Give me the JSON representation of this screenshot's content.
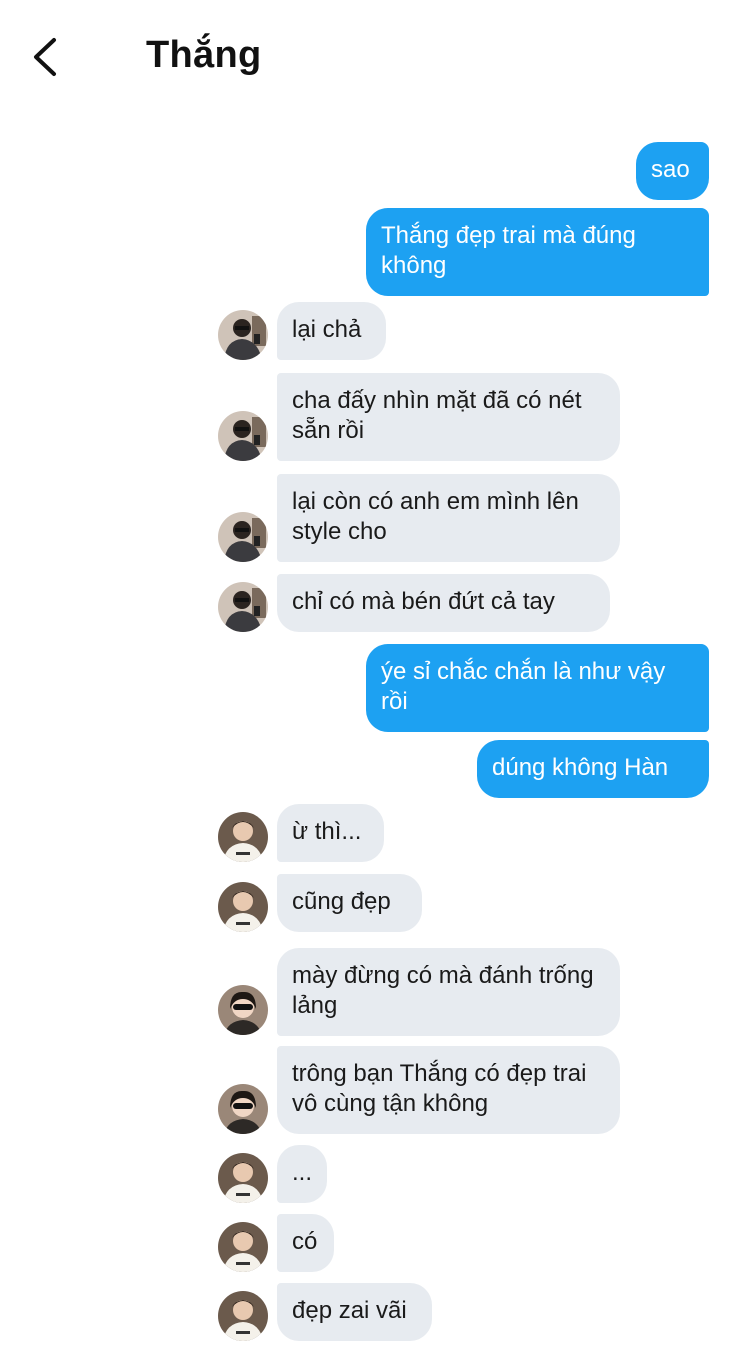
{
  "header": {
    "title": "Thắng",
    "back_icon": "chevron-left-icon"
  },
  "colors": {
    "outgoing": "#1da1f2",
    "incoming": "#e7ebf0"
  },
  "messages": [
    {
      "dir": "out",
      "text": "sao"
    },
    {
      "dir": "out",
      "text": "Thắng đẹp trai mà đúng không"
    },
    {
      "dir": "in",
      "avatar": "friend-a",
      "text": "lại chả"
    },
    {
      "dir": "in",
      "avatar": "friend-a",
      "text": "cha đấy nhìn mặt đã có nét sẵn rồi"
    },
    {
      "dir": "in",
      "avatar": "friend-a",
      "text": "lại còn có anh em mình lên style cho"
    },
    {
      "dir": "in",
      "avatar": "friend-a",
      "text": "chỉ có mà bén đứt cả tay"
    },
    {
      "dir": "out",
      "text": "ýe sỉ chắc chắn là như vậy rồi"
    },
    {
      "dir": "out",
      "text": "dúng không Hàn"
    },
    {
      "dir": "in",
      "avatar": "friend-b",
      "text": "ừ thì..."
    },
    {
      "dir": "in",
      "avatar": "friend-b",
      "text": "cũng đẹp"
    },
    {
      "dir": "in",
      "avatar": "friend-c",
      "text": "mày đừng có mà đánh trống lảng"
    },
    {
      "dir": "in",
      "avatar": "friend-c",
      "text": "trông bạn Thắng có đẹp trai vô cùng tận không"
    },
    {
      "dir": "in",
      "avatar": "friend-b",
      "text": "..."
    },
    {
      "dir": "in",
      "avatar": "friend-b",
      "text": "có"
    },
    {
      "dir": "in",
      "avatar": "friend-b",
      "text": "đẹp zai vãi"
    }
  ]
}
